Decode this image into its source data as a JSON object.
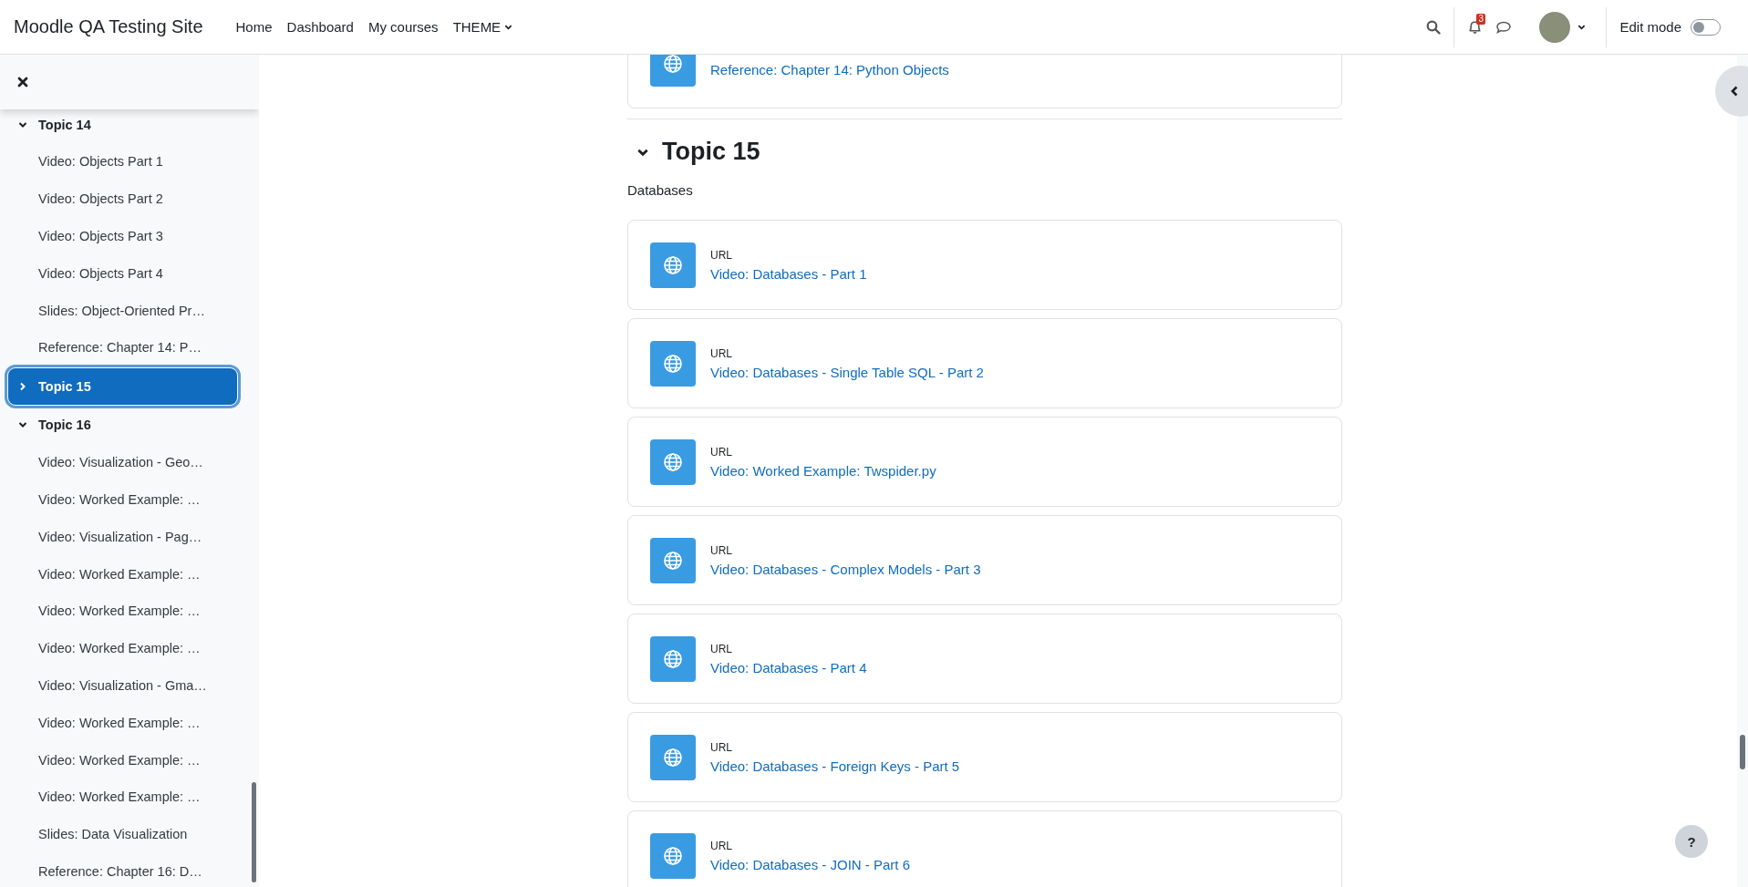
{
  "header": {
    "site_name": "Moodle QA Testing Site",
    "nav": [
      {
        "label": "Home",
        "kind": "link"
      },
      {
        "label": "Dashboard",
        "kind": "link"
      },
      {
        "label": "My courses",
        "kind": "link"
      },
      {
        "label": "THEME",
        "kind": "dropdown"
      }
    ],
    "notification_count": "3",
    "edit_mode": {
      "label": "Edit mode",
      "on": false
    }
  },
  "sidebar": {
    "items": [
      {
        "label": "Topic 14",
        "expanded": true,
        "selected": false,
        "children": [
          {
            "label": "Video: Objects Part 1",
            "selected": false
          },
          {
            "label": "Video: Objects Part 2",
            "selected": false
          },
          {
            "label": "Video: Objects Part 3",
            "selected": false
          },
          {
            "label": "Video: Objects Part 4",
            "selected": false
          },
          {
            "label": "Slides: Object-Oriented Pr…",
            "selected": false
          },
          {
            "label": "Reference: Chapter 14: P…",
            "selected": false
          }
        ]
      },
      {
        "label": "Topic 15",
        "expanded": false,
        "selected": true
      },
      {
        "label": "Topic 16",
        "expanded": true,
        "selected": false,
        "children": [
          {
            "label": "Video: Visualization - Geo…",
            "selected": false
          },
          {
            "label": "Video: Worked Example: …",
            "selected": false
          },
          {
            "label": "Video: Visualization - Pag…",
            "selected": false
          },
          {
            "label": "Video: Worked Example: …",
            "selected": false
          },
          {
            "label": "Video: Worked Example: …",
            "selected": false
          },
          {
            "label": "Video: Worked Example: …",
            "selected": false
          },
          {
            "label": "Video: Visualization - Gma…",
            "selected": false
          },
          {
            "label": "Video: Worked Example: …",
            "selected": false
          },
          {
            "label": "Video: Worked Example: …",
            "selected": false
          },
          {
            "label": "Video: Worked Example: …",
            "selected": false
          },
          {
            "label": "Slides: Data Visualization",
            "selected": false
          },
          {
            "label": "Reference: Chapter 16: D…",
            "selected": false
          }
        ]
      }
    ]
  },
  "previous_activity": {
    "title": "Reference: Chapter 14: Python Objects"
  },
  "section": {
    "title": "Topic 15",
    "expanded": true,
    "summary": "Databases",
    "activities": [
      {
        "type_label": "URL",
        "title": "Video: Databases - Part 1"
      },
      {
        "type_label": "URL",
        "title": "Video: Databases - Single Table SQL - Part 2"
      },
      {
        "type_label": "URL",
        "title": "Video: Worked Example: Twspider.py"
      },
      {
        "type_label": "URL",
        "title": "Video: Databases - Complex Models - Part 3"
      },
      {
        "type_label": "URL",
        "title": "Video: Databases - Part 4"
      },
      {
        "type_label": "URL",
        "title": "Video: Databases - Foreign Keys - Part 5"
      },
      {
        "type_label": "URL",
        "title": "Video: Databases - JOIN - Part 6"
      }
    ]
  },
  "help_button": {
    "label": "?"
  }
}
